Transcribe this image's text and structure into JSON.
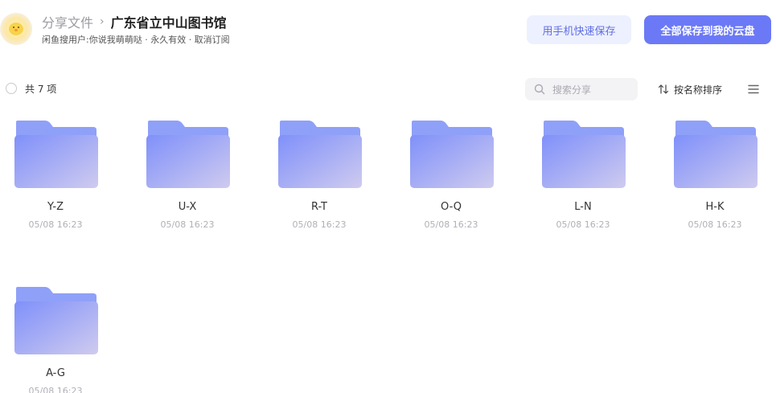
{
  "header": {
    "breadcrumb_root": "分享文件",
    "breadcrumb_separator": "›",
    "breadcrumb_current": "广东省立中山图书馆",
    "subinfo": "闲鱼搜用户:你说我萌萌哒 · 永久有效 · 取消订阅",
    "save_mobile_label": "用手机快速保存",
    "save_all_label": "全部保存到我的云盘"
  },
  "toolbar": {
    "count_label": "共 7 项",
    "search_placeholder": "搜索分享",
    "sort_label": "按名称排序"
  },
  "folders": [
    {
      "name": "Y-Z",
      "date": "05/08 16:23"
    },
    {
      "name": "U-X",
      "date": "05/08 16:23"
    },
    {
      "name": "R-T",
      "date": "05/08 16:23"
    },
    {
      "name": "O-Q",
      "date": "05/08 16:23"
    },
    {
      "name": "L-N",
      "date": "05/08 16:23"
    },
    {
      "name": "H-K",
      "date": "05/08 16:23"
    },
    {
      "name": "A-G",
      "date": "05/08 16:23"
    }
  ],
  "icons": {
    "avatar": "chick-avatar",
    "search": "search-icon",
    "sort": "sort-arrows-icon",
    "view": "list-view-icon",
    "folder": "folder-icon"
  },
  "colors": {
    "accent": "#6b79f6",
    "accent_light": "#edf0fe",
    "folder_top": "#8fa0f8",
    "folder_front_start": "#7f90fa",
    "folder_front_end": "#cfcbef"
  }
}
